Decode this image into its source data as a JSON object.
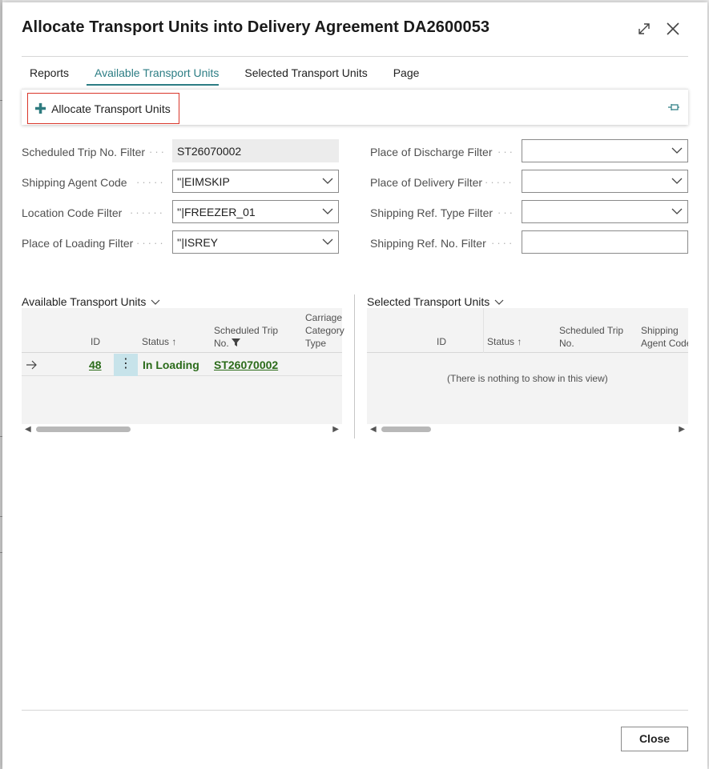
{
  "dialog": {
    "title": "Allocate Transport Units into Delivery Agreement DA2600053"
  },
  "tabs": [
    {
      "label": "Reports"
    },
    {
      "label": "Available Transport Units"
    },
    {
      "label": "Selected Transport Units"
    },
    {
      "label": "Page"
    }
  ],
  "action": {
    "allocate_label": "Allocate Transport Units"
  },
  "fields_left": [
    {
      "label": "Scheduled Trip No. Filter",
      "value": "ST26070002"
    },
    {
      "label": "Shipping Agent Code",
      "value": "''|EIMSKIP"
    },
    {
      "label": "Location Code Filter",
      "value": "''|FREEZER_01"
    },
    {
      "label": "Place of Loading Filter",
      "value": "''|ISREY"
    }
  ],
  "fields_right": [
    {
      "label": "Place of Discharge Filter",
      "value": ""
    },
    {
      "label": "Place of Delivery Filter",
      "value": ""
    },
    {
      "label": "Shipping Ref. Type Filter",
      "value": ""
    },
    {
      "label": "Shipping Ref. No. Filter",
      "value": ""
    }
  ],
  "available": {
    "title": "Available Transport Units",
    "columns": {
      "id": "ID",
      "status": "Status",
      "trip_line1": "Scheduled Trip",
      "trip_line2": "No.",
      "carriage_1": "Carriage",
      "carriage_2": "Category",
      "carriage_3": "Type"
    },
    "rows": [
      {
        "id": "48",
        "status": "In Loading",
        "trip": "ST26070002"
      }
    ]
  },
  "selected": {
    "title": "Selected Transport Units",
    "columns": {
      "id": "ID",
      "status": "Status",
      "trip_line1": "Scheduled Trip",
      "trip_line2": "No.",
      "agent_line1": "Shipping",
      "agent_line2": "Agent Code"
    },
    "empty_text": "(There is nothing to show in this view)"
  },
  "footer": {
    "close_label": "Close"
  },
  "colors": {
    "accent": "#2c7d84",
    "link_green": "#2b6b1a",
    "highlight_border": "#d9362a",
    "selected_cell": "#c7e3ea"
  }
}
